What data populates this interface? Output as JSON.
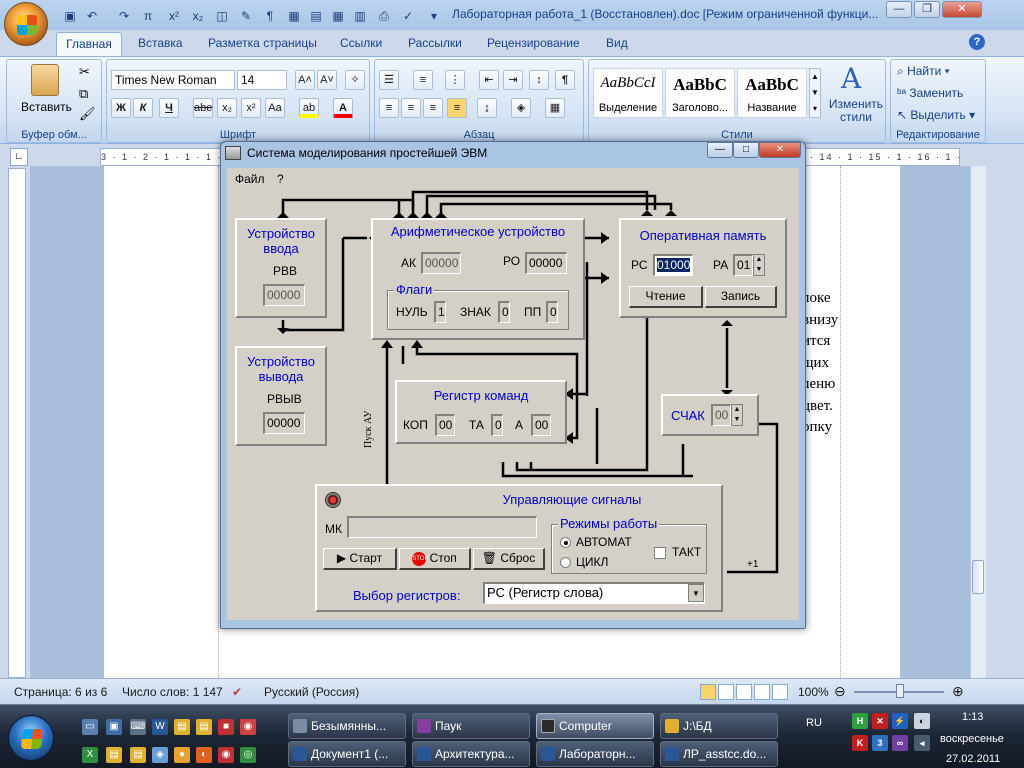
{
  "word": {
    "title": "Лабораторная работа_1 (Восстановлен).doc [Режим ограниченной функци...",
    "tabs": [
      "Главная",
      "Вставка",
      "Разметка страницы",
      "Ссылки",
      "Рассылки",
      "Рецензирование",
      "Вид"
    ],
    "clipboard": {
      "paste_label": "Вставить",
      "group_label": "Буфер обм..."
    },
    "font": {
      "name": "Times New Roman",
      "size": "14",
      "group_label": "Шрифт"
    },
    "paragraph": {
      "group_label": "Абзац"
    },
    "styles": {
      "group_label": "Стили",
      "cards": [
        {
          "sample": "AaBbCcI",
          "name": "Выделение"
        },
        {
          "sample": "AaBbC",
          "name": "Заголово..."
        },
        {
          "sample": "AaBbC",
          "name": "Название"
        }
      ],
      "change_label": "Изменить стили"
    },
    "editing": {
      "find": "Найти",
      "replace": "Заменить",
      "select": "Выделить",
      "group_label": "Редактирование"
    },
    "ruler_text": "3 · 1 · 2 · 1 · 1 · 1 · · · 1 · 1 · 2 · 1 · 3 · 1 · 4 · 1 · 5 · 1 · 6 · 1 · 7 · 1 · 8 · 1 · 9 · 1 · 10 · 1 · 11 · 1 · 12 · 1 · 13 · 1 · 14 · 1 · 15 · 1 · 16 · 1 · 17 ·",
    "doc_lines": [
      "локе",
      "внизу",
      "ится",
      "щих",
      "леню",
      "цвет.",
      "опку"
    ],
    "status": {
      "page": "Страница: 6 из 6",
      "words": "Число слов: 1 147",
      "lang": "Русский (Россия)",
      "zoom": "100%"
    }
  },
  "emulator": {
    "title": "Система моделирования простейшей ЭВМ",
    "menu": [
      "Файл",
      "?"
    ],
    "input_device": {
      "title": "Устройство ввода",
      "reg_label": "РВВ",
      "reg_value": "00000"
    },
    "output_device": {
      "title": "Устройство вывода",
      "reg_label": "РВЫВ",
      "reg_value": "00000"
    },
    "alu": {
      "title": "Арифметическое устройство",
      "ak_label": "АК",
      "ak_value": "00000",
      "ro_label": "РО",
      "ro_value": "00000",
      "flags_title": "Флаги",
      "zero_label": "НУЛЬ",
      "zero_value": "1",
      "sign_label": "ЗНАК",
      "sign_value": "0",
      "overflow_label": "ПП",
      "overflow_value": "0"
    },
    "memory": {
      "title": "Оперативная память",
      "rs_label": "РС",
      "rs_value": "01000",
      "ra_label": "РА",
      "ra_value": "01",
      "read_label": "Чтение",
      "write_label": "Запись"
    },
    "cmd_register": {
      "title": "Регистр команд",
      "kop_label": "КОП",
      "kop_value": "00",
      "ta_label": "ТА",
      "ta_value": "0",
      "a_label": "А",
      "a_value": "00"
    },
    "counter": {
      "label": "СЧАК",
      "value": "00"
    },
    "control": {
      "title": "Управляющие сигналы",
      "mk_label": "МК",
      "mk_value": "",
      "start_label": "Старт",
      "stop_label": "Стоп",
      "reset_label": "Сброс",
      "modes_title": "Режимы работы",
      "mode_auto": "АВТОМАТ",
      "mode_cycle": "ЦИКЛ",
      "mode_tact": "ТАКТ",
      "reg_select_label": "Выбор регистров:",
      "reg_select_value": "РС (Регистр слова)"
    },
    "wire_labels": {
      "start_au": "Пуск АУ",
      "plus_one": "+1"
    }
  },
  "taskbar": {
    "row1": [
      "Безымянны...",
      "Паук",
      "Computer",
      "J:\\БД"
    ],
    "row2": [
      "Документ1 (...",
      "Архитектура...",
      "Лабораторн...",
      "ЛР_asstcc.do..."
    ],
    "lang": "RU",
    "time": "1:13",
    "day": "воскресенье",
    "date": "27.02.2011"
  }
}
